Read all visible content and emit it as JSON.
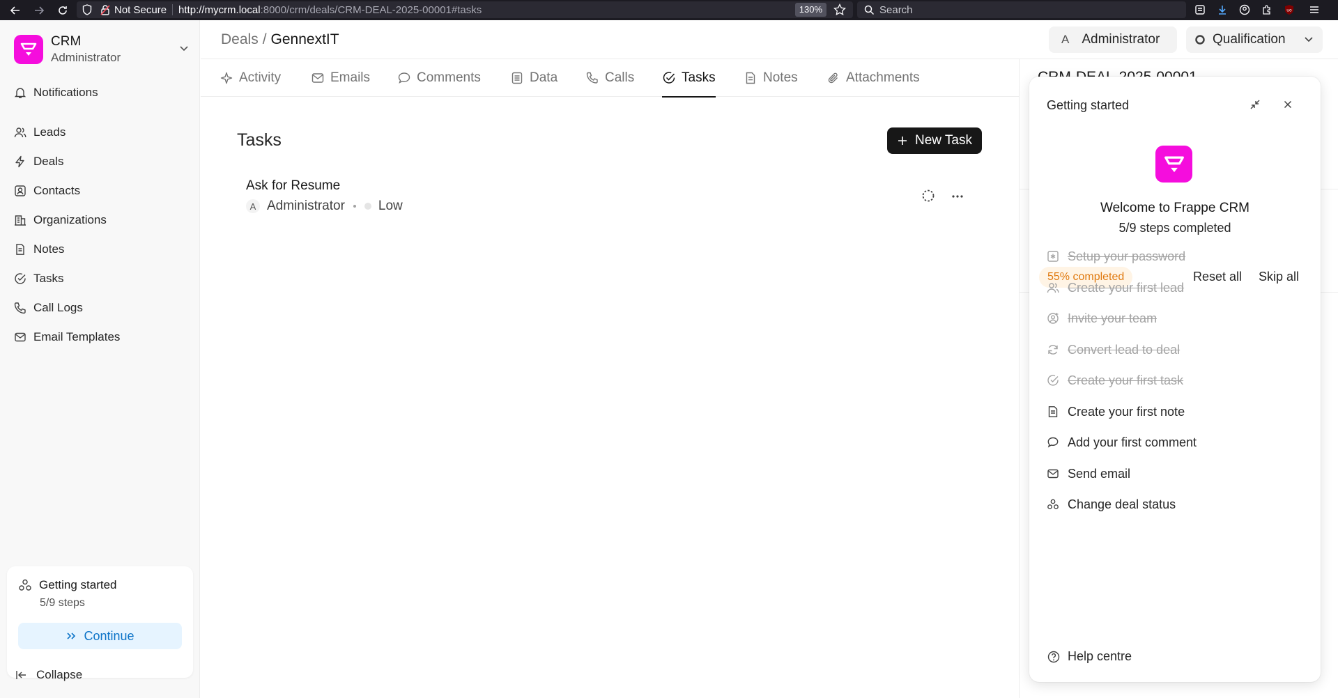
{
  "browser": {
    "security_label": "Not Secure",
    "url_host": "http://mycrm.local",
    "url_rest": ":8000/crm/deals/CRM-DEAL-2025-00001#tasks",
    "zoom": "130%",
    "search_placeholder": "Search"
  },
  "sidebar": {
    "brand_title": "CRM",
    "brand_subtitle": "Administrator",
    "items": [
      {
        "label": "Notifications",
        "icon": "bell-icon"
      },
      {
        "label": "Leads",
        "icon": "users-icon"
      },
      {
        "label": "Deals",
        "icon": "lightning-icon"
      },
      {
        "label": "Contacts",
        "icon": "contact-icon"
      },
      {
        "label": "Organizations",
        "icon": "building-icon"
      },
      {
        "label": "Notes",
        "icon": "note-icon"
      },
      {
        "label": "Tasks",
        "icon": "check-circle-icon"
      },
      {
        "label": "Call Logs",
        "icon": "phone-icon"
      },
      {
        "label": "Email Templates",
        "icon": "mail-icon"
      }
    ],
    "getting_started": {
      "title": "Getting started",
      "steps": "5/9 steps",
      "continue_label": "Continue"
    },
    "collapse_label": "Collapse"
  },
  "header": {
    "crumb_parent": "Deals",
    "crumb_sep": "/",
    "crumb_current": "GennextIT",
    "owner_avatar": "A",
    "owner_name": "Administrator",
    "status": "Qualification"
  },
  "tabs": [
    {
      "label": "Activity",
      "icon": "activity-icon"
    },
    {
      "label": "Emails",
      "icon": "mail-icon"
    },
    {
      "label": "Comments",
      "icon": "comment-icon"
    },
    {
      "label": "Data",
      "icon": "data-icon"
    },
    {
      "label": "Calls",
      "icon": "phone-icon"
    },
    {
      "label": "Tasks",
      "icon": "check-circle-icon",
      "active": true
    },
    {
      "label": "Notes",
      "icon": "note-icon"
    },
    {
      "label": "Attachments",
      "icon": "paperclip-icon"
    }
  ],
  "main": {
    "title": "Tasks",
    "new_task_label": "New Task",
    "task": {
      "title": "Ask for Resume",
      "assignee_avatar": "A",
      "assignee": "Administrator",
      "priority": "Low"
    }
  },
  "right_panel": {
    "title": "CRM-DEAL-2025-00001"
  },
  "popover": {
    "title": "Getting started",
    "welcome": "Welcome to Frappe CRM",
    "steps_completed": "5/9 steps completed",
    "percent_label": "55% completed",
    "progress_fraction": 0.55,
    "reset_label": "Reset all",
    "skip_label": "Skip all",
    "steps": [
      {
        "label": "Setup your password",
        "done": true,
        "icon": "asterisk-icon"
      },
      {
        "label": "Create your first lead",
        "done": true,
        "icon": "users-icon"
      },
      {
        "label": "Invite your team",
        "done": true,
        "icon": "user-plus-icon"
      },
      {
        "label": "Convert lead to deal",
        "done": true,
        "icon": "refresh-icon"
      },
      {
        "label": "Create your first task",
        "done": true,
        "icon": "check-circle-icon"
      },
      {
        "label": "Create your first note",
        "done": false,
        "icon": "note-icon"
      },
      {
        "label": "Add your first comment",
        "done": false,
        "icon": "comment-icon"
      },
      {
        "label": "Send email",
        "done": false,
        "icon": "mail-icon"
      },
      {
        "label": "Change deal status",
        "done": false,
        "icon": "status-icon"
      }
    ],
    "help_label": "Help centre"
  },
  "colors": {
    "brand": "#f50ddd",
    "accent_blue": "#0d74c8",
    "badge_orange": "#e07a10"
  }
}
